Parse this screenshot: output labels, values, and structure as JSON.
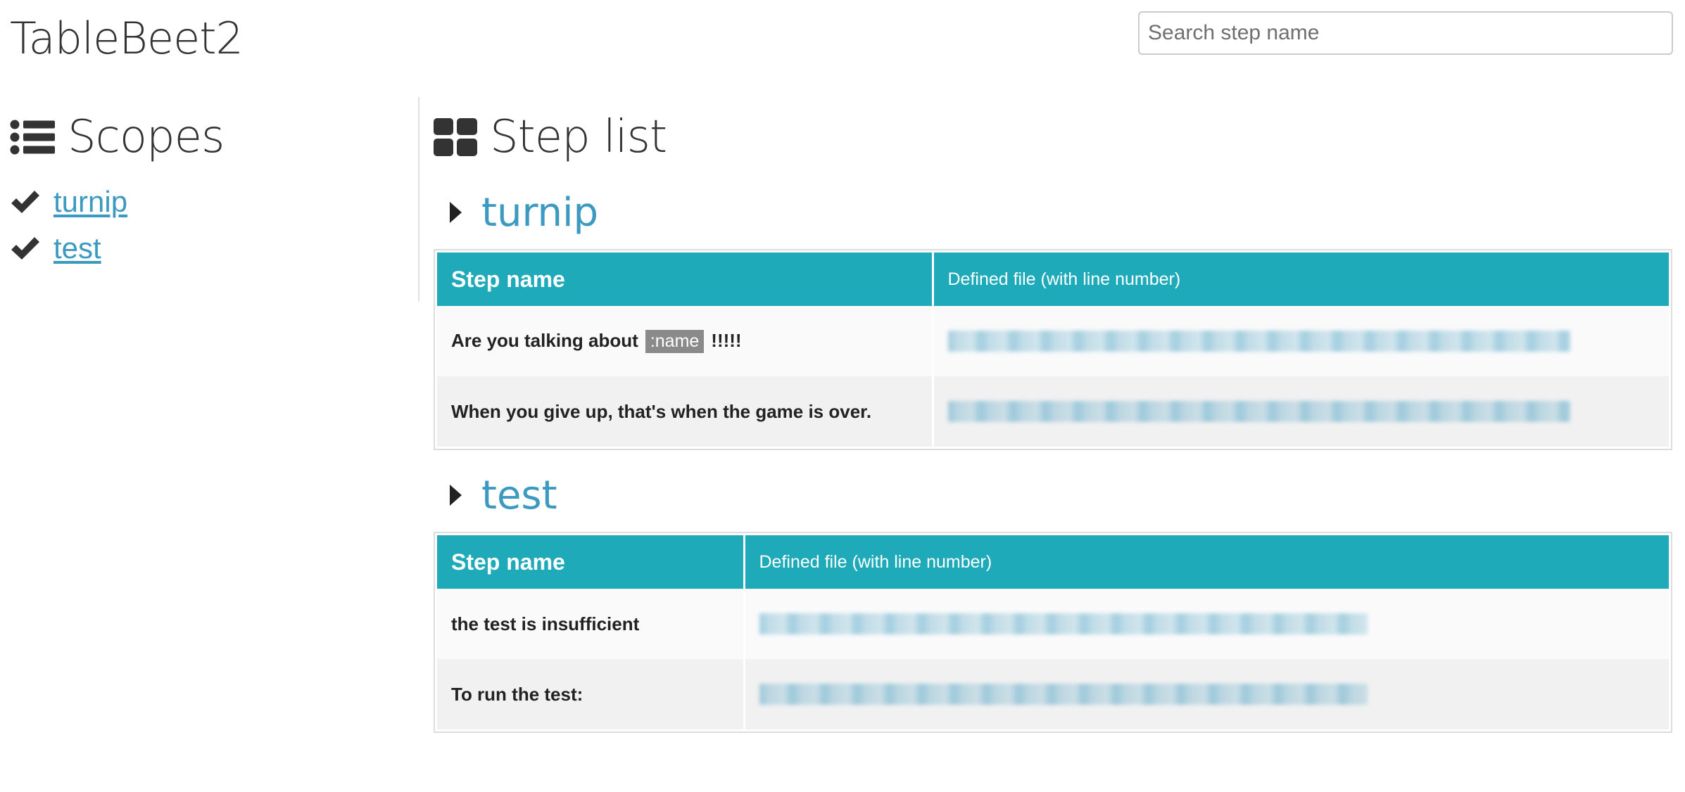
{
  "header": {
    "brand": "TableBeet2",
    "search_placeholder": "Search step name",
    "search_value": ""
  },
  "sidebar": {
    "heading": "Scopes",
    "heading_icon": "list-icon",
    "scopes": [
      {
        "label": "turnip",
        "icon": "check-icon"
      },
      {
        "label": "test",
        "icon": "check-icon"
      }
    ]
  },
  "main": {
    "heading": "Step list",
    "heading_icon": "grid-icon",
    "sections": [
      {
        "title": "turnip",
        "icon": "caret-right-icon",
        "columns": [
          "Step name",
          "Defined file (with line number)"
        ],
        "rows": [
          {
            "step_prefix": "Are you talking about",
            "param": ":name",
            "step_suffix": "!!!!!",
            "file": "(blurred file path)"
          },
          {
            "step_prefix": "When you give up, that's when the game is over.",
            "param": "",
            "step_suffix": "",
            "file": "(blurred file path)"
          }
        ]
      },
      {
        "title": "test",
        "icon": "caret-right-icon",
        "columns": [
          "Step name",
          "Defined file (with line number)"
        ],
        "rows": [
          {
            "step_prefix": "the test is insufficient",
            "param": "",
            "step_suffix": "",
            "file": "(blurred file path)"
          },
          {
            "step_prefix": "To run the test:",
            "param": "",
            "step_suffix": "",
            "file": "(blurred file path)"
          }
        ]
      }
    ]
  },
  "colors": {
    "accent": "#1eaab8",
    "link": "#3c9ac0",
    "text": "#333333",
    "param_badge": "#8a8a8a"
  }
}
